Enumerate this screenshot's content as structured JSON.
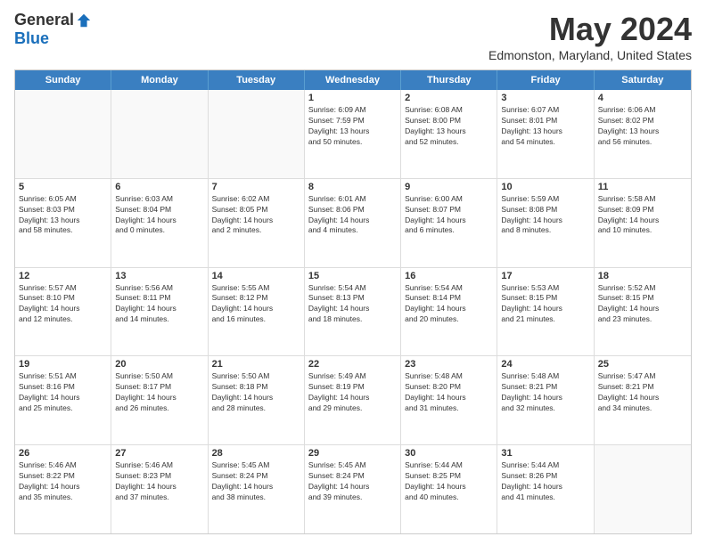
{
  "logo": {
    "general": "General",
    "blue": "Blue"
  },
  "title": "May 2024",
  "location": "Edmonston, Maryland, United States",
  "days_of_week": [
    "Sunday",
    "Monday",
    "Tuesday",
    "Wednesday",
    "Thursday",
    "Friday",
    "Saturday"
  ],
  "weeks": [
    [
      {
        "day": "",
        "info": ""
      },
      {
        "day": "",
        "info": ""
      },
      {
        "day": "",
        "info": ""
      },
      {
        "day": "1",
        "info": "Sunrise: 6:09 AM\nSunset: 7:59 PM\nDaylight: 13 hours\nand 50 minutes."
      },
      {
        "day": "2",
        "info": "Sunrise: 6:08 AM\nSunset: 8:00 PM\nDaylight: 13 hours\nand 52 minutes."
      },
      {
        "day": "3",
        "info": "Sunrise: 6:07 AM\nSunset: 8:01 PM\nDaylight: 13 hours\nand 54 minutes."
      },
      {
        "day": "4",
        "info": "Sunrise: 6:06 AM\nSunset: 8:02 PM\nDaylight: 13 hours\nand 56 minutes."
      }
    ],
    [
      {
        "day": "5",
        "info": "Sunrise: 6:05 AM\nSunset: 8:03 PM\nDaylight: 13 hours\nand 58 minutes."
      },
      {
        "day": "6",
        "info": "Sunrise: 6:03 AM\nSunset: 8:04 PM\nDaylight: 14 hours\nand 0 minutes."
      },
      {
        "day": "7",
        "info": "Sunrise: 6:02 AM\nSunset: 8:05 PM\nDaylight: 14 hours\nand 2 minutes."
      },
      {
        "day": "8",
        "info": "Sunrise: 6:01 AM\nSunset: 8:06 PM\nDaylight: 14 hours\nand 4 minutes."
      },
      {
        "day": "9",
        "info": "Sunrise: 6:00 AM\nSunset: 8:07 PM\nDaylight: 14 hours\nand 6 minutes."
      },
      {
        "day": "10",
        "info": "Sunrise: 5:59 AM\nSunset: 8:08 PM\nDaylight: 14 hours\nand 8 minutes."
      },
      {
        "day": "11",
        "info": "Sunrise: 5:58 AM\nSunset: 8:09 PM\nDaylight: 14 hours\nand 10 minutes."
      }
    ],
    [
      {
        "day": "12",
        "info": "Sunrise: 5:57 AM\nSunset: 8:10 PM\nDaylight: 14 hours\nand 12 minutes."
      },
      {
        "day": "13",
        "info": "Sunrise: 5:56 AM\nSunset: 8:11 PM\nDaylight: 14 hours\nand 14 minutes."
      },
      {
        "day": "14",
        "info": "Sunrise: 5:55 AM\nSunset: 8:12 PM\nDaylight: 14 hours\nand 16 minutes."
      },
      {
        "day": "15",
        "info": "Sunrise: 5:54 AM\nSunset: 8:13 PM\nDaylight: 14 hours\nand 18 minutes."
      },
      {
        "day": "16",
        "info": "Sunrise: 5:54 AM\nSunset: 8:14 PM\nDaylight: 14 hours\nand 20 minutes."
      },
      {
        "day": "17",
        "info": "Sunrise: 5:53 AM\nSunset: 8:15 PM\nDaylight: 14 hours\nand 21 minutes."
      },
      {
        "day": "18",
        "info": "Sunrise: 5:52 AM\nSunset: 8:15 PM\nDaylight: 14 hours\nand 23 minutes."
      }
    ],
    [
      {
        "day": "19",
        "info": "Sunrise: 5:51 AM\nSunset: 8:16 PM\nDaylight: 14 hours\nand 25 minutes."
      },
      {
        "day": "20",
        "info": "Sunrise: 5:50 AM\nSunset: 8:17 PM\nDaylight: 14 hours\nand 26 minutes."
      },
      {
        "day": "21",
        "info": "Sunrise: 5:50 AM\nSunset: 8:18 PM\nDaylight: 14 hours\nand 28 minutes."
      },
      {
        "day": "22",
        "info": "Sunrise: 5:49 AM\nSunset: 8:19 PM\nDaylight: 14 hours\nand 29 minutes."
      },
      {
        "day": "23",
        "info": "Sunrise: 5:48 AM\nSunset: 8:20 PM\nDaylight: 14 hours\nand 31 minutes."
      },
      {
        "day": "24",
        "info": "Sunrise: 5:48 AM\nSunset: 8:21 PM\nDaylight: 14 hours\nand 32 minutes."
      },
      {
        "day": "25",
        "info": "Sunrise: 5:47 AM\nSunset: 8:21 PM\nDaylight: 14 hours\nand 34 minutes."
      }
    ],
    [
      {
        "day": "26",
        "info": "Sunrise: 5:46 AM\nSunset: 8:22 PM\nDaylight: 14 hours\nand 35 minutes."
      },
      {
        "day": "27",
        "info": "Sunrise: 5:46 AM\nSunset: 8:23 PM\nDaylight: 14 hours\nand 37 minutes."
      },
      {
        "day": "28",
        "info": "Sunrise: 5:45 AM\nSunset: 8:24 PM\nDaylight: 14 hours\nand 38 minutes."
      },
      {
        "day": "29",
        "info": "Sunrise: 5:45 AM\nSunset: 8:24 PM\nDaylight: 14 hours\nand 39 minutes."
      },
      {
        "day": "30",
        "info": "Sunrise: 5:44 AM\nSunset: 8:25 PM\nDaylight: 14 hours\nand 40 minutes."
      },
      {
        "day": "31",
        "info": "Sunrise: 5:44 AM\nSunset: 8:26 PM\nDaylight: 14 hours\nand 41 minutes."
      },
      {
        "day": "",
        "info": ""
      }
    ]
  ]
}
